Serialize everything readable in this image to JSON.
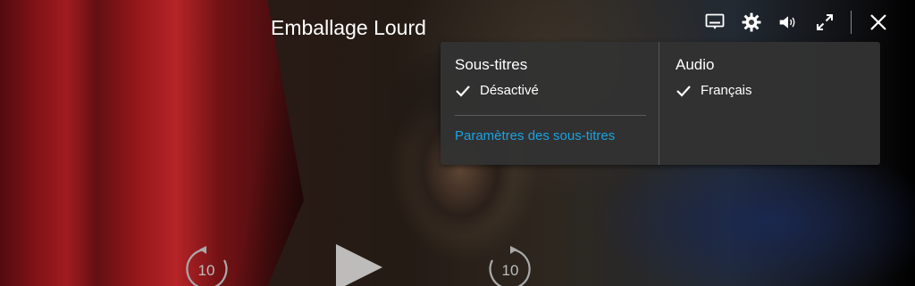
{
  "video": {
    "title": "Emballage Lourd"
  },
  "top_controls": {
    "icons": [
      "subtitles-icon",
      "gear-icon",
      "volume-icon",
      "fullscreen-icon",
      "close-icon"
    ]
  },
  "subtitles_menu": {
    "heading": "Sous-titres",
    "selected_option": "Désactivé",
    "settings_link": "Paramètres des sous-titres"
  },
  "audio_menu": {
    "heading": "Audio",
    "selected_option": "Français"
  },
  "playback": {
    "rewind_seconds": "10",
    "forward_seconds": "10"
  },
  "colors": {
    "accent_link": "#1aa3e0",
    "menu_background": "#323232",
    "text": "#ffffff"
  }
}
